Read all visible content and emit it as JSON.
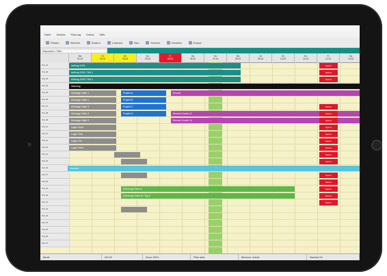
{
  "app": {
    "window_title": ""
  },
  "menu": [
    "Datei",
    "Ansicht",
    "Planung",
    "Extras",
    "Hilfe"
  ],
  "toolbar": [
    "Planen",
    "Buchen",
    "Ändern",
    "Löschen",
    "Neu",
    "Suchen",
    "Drucken",
    "Export"
  ],
  "filter": {
    "label": "Disposition / Filter"
  },
  "days": [
    {
      "label": "Mo",
      "date": "01.03",
      "highlight": "none"
    },
    {
      "label": "Di",
      "date": "02.03",
      "highlight": "yellow"
    },
    {
      "label": "Mi",
      "date": "03.03",
      "highlight": "yellow"
    },
    {
      "label": "Do",
      "date": "04.03",
      "highlight": "none"
    },
    {
      "label": "Fr",
      "date": "05.03",
      "highlight": "red"
    },
    {
      "label": "Sa",
      "date": "06.03",
      "highlight": "none"
    },
    {
      "label": "So",
      "date": "07.03",
      "highlight": "none"
    },
    {
      "label": "Mo",
      "date": "08.03",
      "highlight": "none"
    },
    {
      "label": "Di",
      "date": "09.03",
      "highlight": "none"
    },
    {
      "label": "Mi",
      "date": "10.03",
      "highlight": "none"
    },
    {
      "label": "Do",
      "date": "11.03",
      "highlight": "none"
    },
    {
      "label": "Fr",
      "date": "12.03",
      "highlight": "none"
    },
    {
      "label": "Sa",
      "date": "13.03",
      "highlight": "none"
    }
  ],
  "rows": [
    "Pos 01",
    "Pos 02",
    "Pos 03",
    "Pos 04",
    "Pos 05",
    "Pos 06",
    "Pos 07",
    "Pos 08",
    "Pos 09",
    "Pos 10",
    "Pos 11",
    "Pos 12",
    "Pos 13",
    "Pos 14",
    "Pos 15",
    "Pos 16",
    "Pos 17",
    "Pos 18",
    "Pos 19",
    "Pos 20",
    "Pos 21",
    "Pos 22",
    "Pos 23",
    "Pos 24",
    "Pos 25",
    "Pos 26",
    "Pos 27"
  ],
  "bars": [
    {
      "color": "teal",
      "label": "Auftrag 1001"
    },
    {
      "color": "teal",
      "label": "Auftrag 1002 / Teil 1"
    },
    {
      "color": "teal",
      "label": "Auftrag 1003 / Teil 2"
    },
    {
      "color": "black",
      "label": "Wartung"
    },
    {
      "color": "grey",
      "label": "Montage Halle 1"
    },
    {
      "color": "blue",
      "label": "Projekt A"
    },
    {
      "color": "magenta",
      "label": "Service"
    },
    {
      "color": "grey",
      "label": "Montage Halle 2"
    },
    {
      "color": "blue",
      "label": "Projekt B"
    },
    {
      "color": "grey",
      "label": "Montage Halle 3"
    },
    {
      "color": "blue",
      "label": "Projekt C"
    },
    {
      "color": "grey",
      "label": "Montage Halle 4"
    },
    {
      "color": "blue",
      "label": "Projekt D"
    },
    {
      "color": "magenta",
      "label": "Service Kunde 12"
    },
    {
      "color": "grey",
      "label": "Montage Halle 5"
    },
    {
      "color": "magenta",
      "label": "Service Kunde 14"
    },
    {
      "color": "grey",
      "label": "Lager Nord"
    },
    {
      "color": "grey",
      "label": "Lager Süd"
    },
    {
      "color": "grey",
      "label": "Lager Ost"
    },
    {
      "color": "grey",
      "label": "Lager West"
    },
    {
      "color": "cyan",
      "label": "Inventur"
    },
    {
      "color": "green",
      "label": "Schulung Team A"
    },
    {
      "color": "green",
      "label": "Schulung Team B / Tag 2"
    }
  ],
  "red_cell_label": "Sperre",
  "status": [
    "Bereit",
    "KW 09",
    "Zoom 100%",
    "Filter aktiv",
    "Benutzer: Admin",
    "Mandant 01"
  ]
}
